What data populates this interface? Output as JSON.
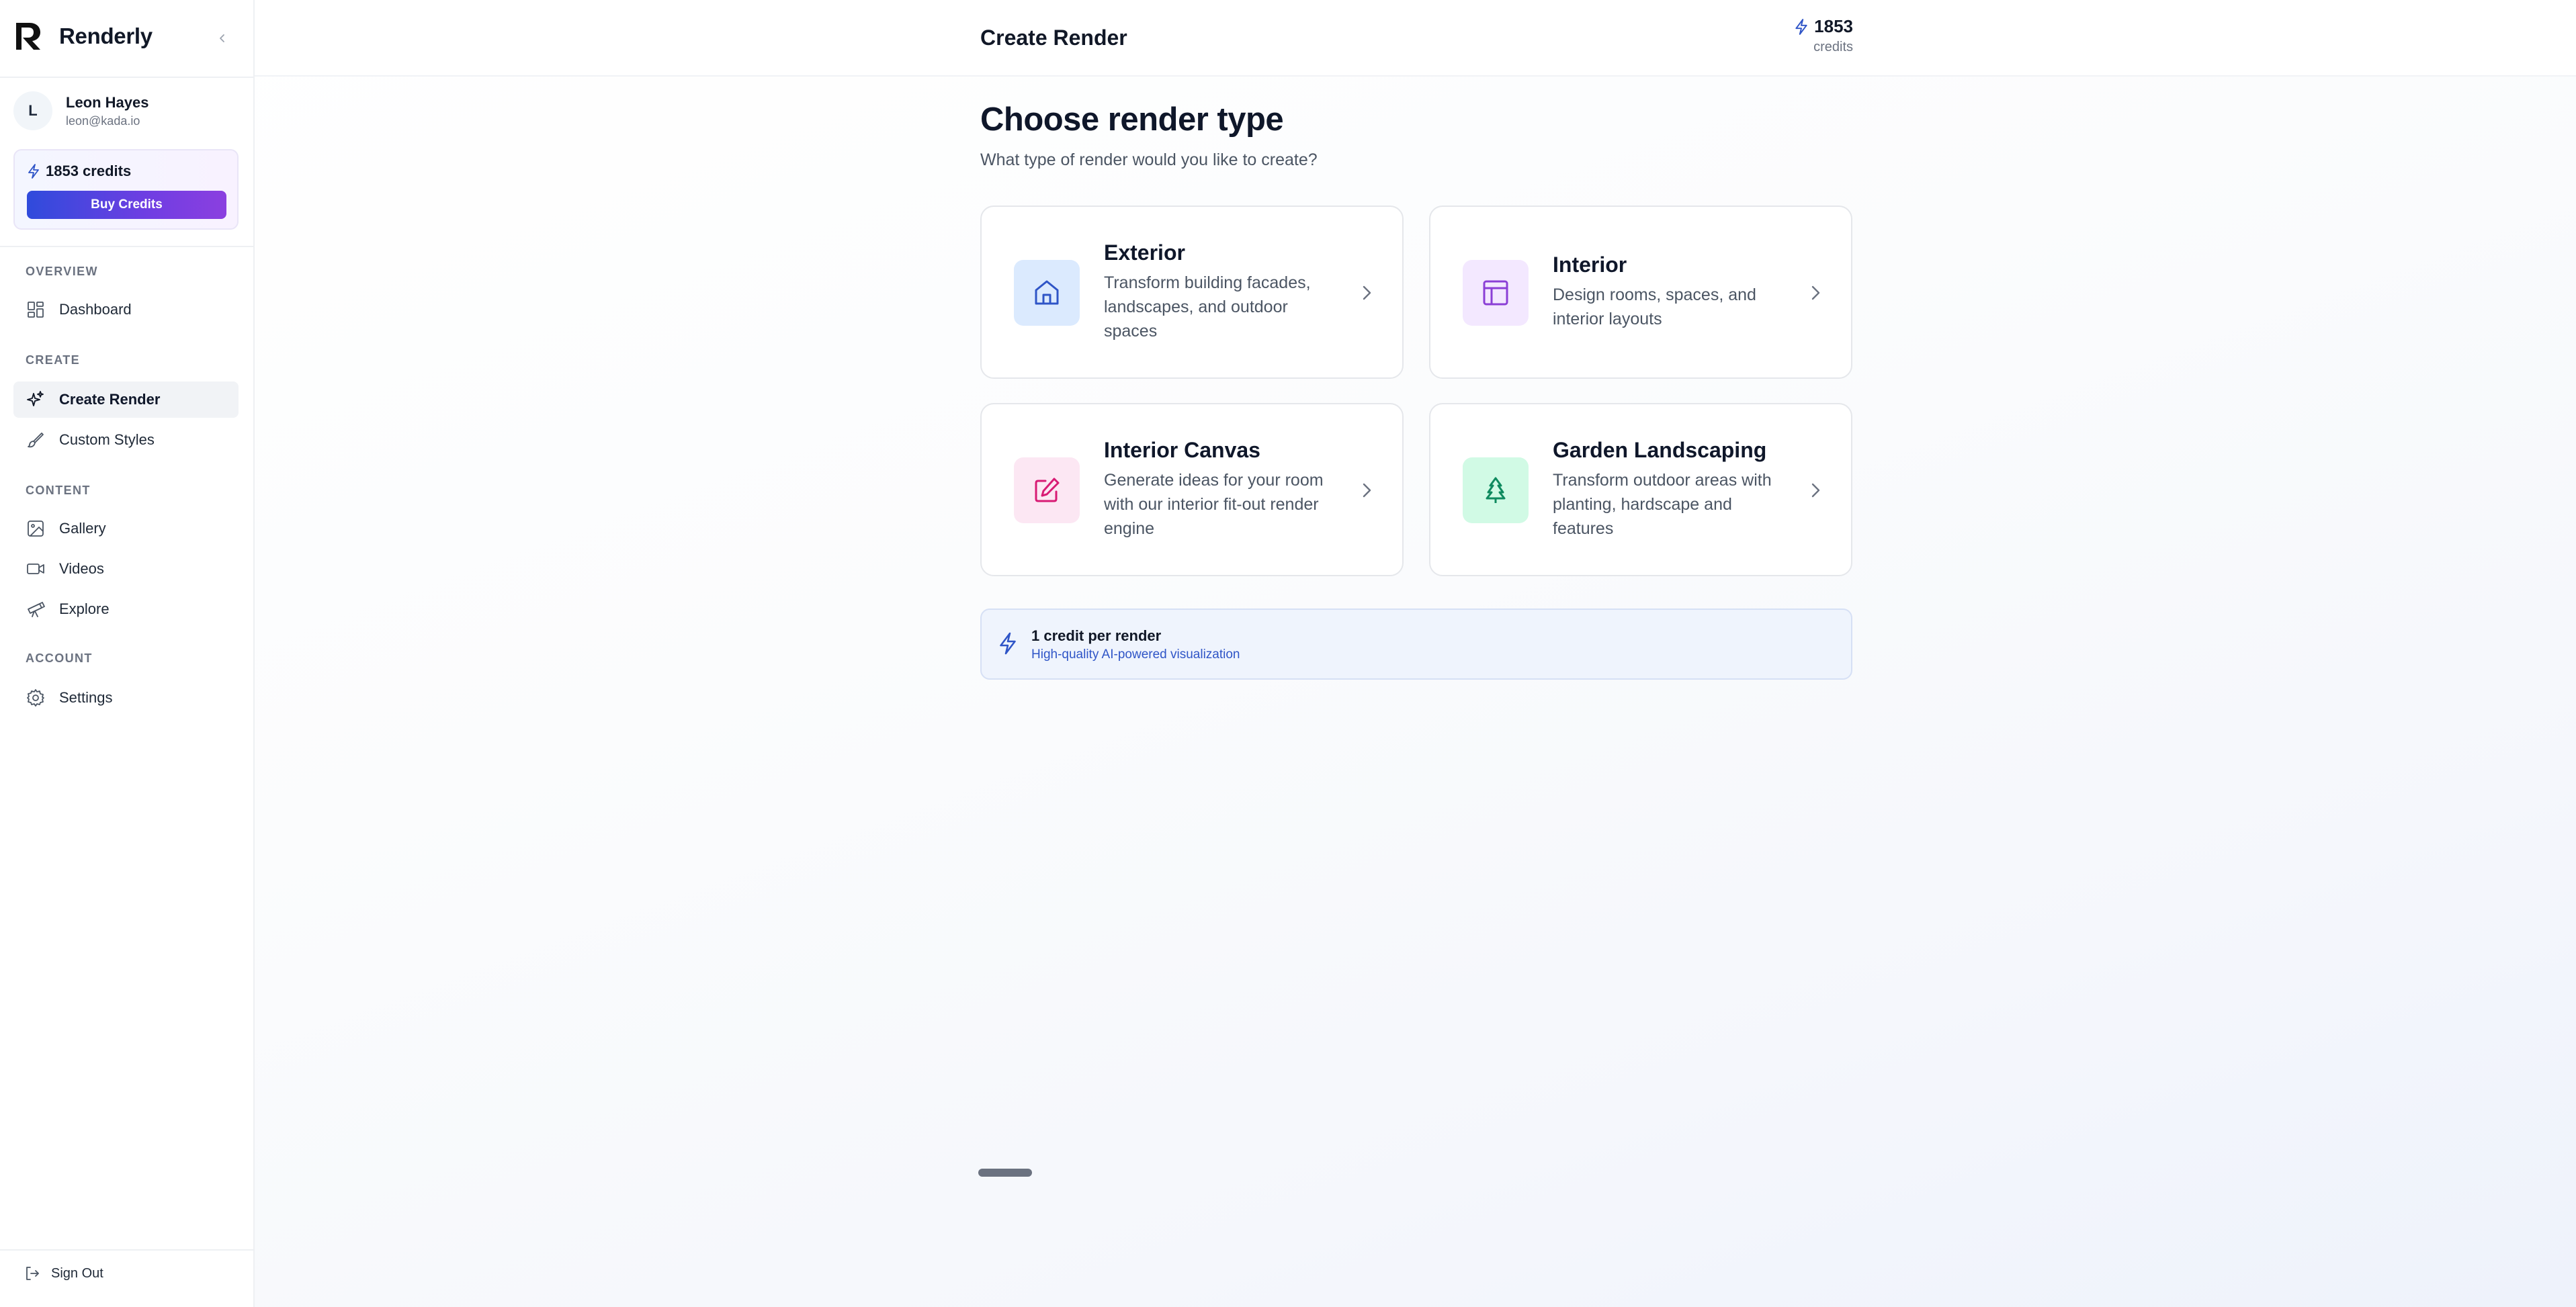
{
  "app": {
    "name": "Renderly"
  },
  "user": {
    "initial": "L",
    "name": "Leon Hayes",
    "email": "leon@kada.io"
  },
  "credits_card": {
    "label": "1853 credits",
    "buy_label": "Buy Credits"
  },
  "nav": {
    "overview_label": "OVERVIEW",
    "create_label": "CREATE",
    "content_label": "CONTENT",
    "account_label": "ACCOUNT",
    "dashboard": "Dashboard",
    "create_render": "Create Render",
    "custom_styles": "Custom Styles",
    "gallery": "Gallery",
    "videos": "Videos",
    "explore": "Explore",
    "settings": "Settings",
    "sign_out": "Sign Out"
  },
  "header": {
    "title": "Create Render",
    "credits_value": "1853",
    "credits_unit": "credits"
  },
  "page": {
    "heading": "Choose render type",
    "subheading": "What type of render would you like to create?"
  },
  "cards": [
    {
      "title": "Exterior",
      "desc": "Transform building facades, landscapes, and outdoor spaces",
      "icon": "home-icon",
      "bg": "#dbeafe",
      "fg": "#2f55c7"
    },
    {
      "title": "Interior",
      "desc": "Design rooms, spaces, and interior layouts",
      "icon": "layout-icon",
      "bg": "#f3e8ff",
      "fg": "#8b3fd6"
    },
    {
      "title": "Interior Canvas",
      "desc": "Generate ideas for your room with our interior fit-out render engine",
      "icon": "pencil-square-icon",
      "bg": "#fce7f3",
      "fg": "#d81b74"
    },
    {
      "title": "Garden Landscaping",
      "desc": "Transform outdoor areas with planting, hardscape and features",
      "icon": "tree-icon",
      "bg": "#d1fae5",
      "fg": "#0f8a5f"
    }
  ],
  "info": {
    "title": "1 credit per render",
    "subtitle": "High-quality AI-powered visualization"
  },
  "colors": {
    "accent_blue": "#2f55c7",
    "buy_gradient_start": "#2f4bdc",
    "buy_gradient_end": "#8b3fe0"
  }
}
